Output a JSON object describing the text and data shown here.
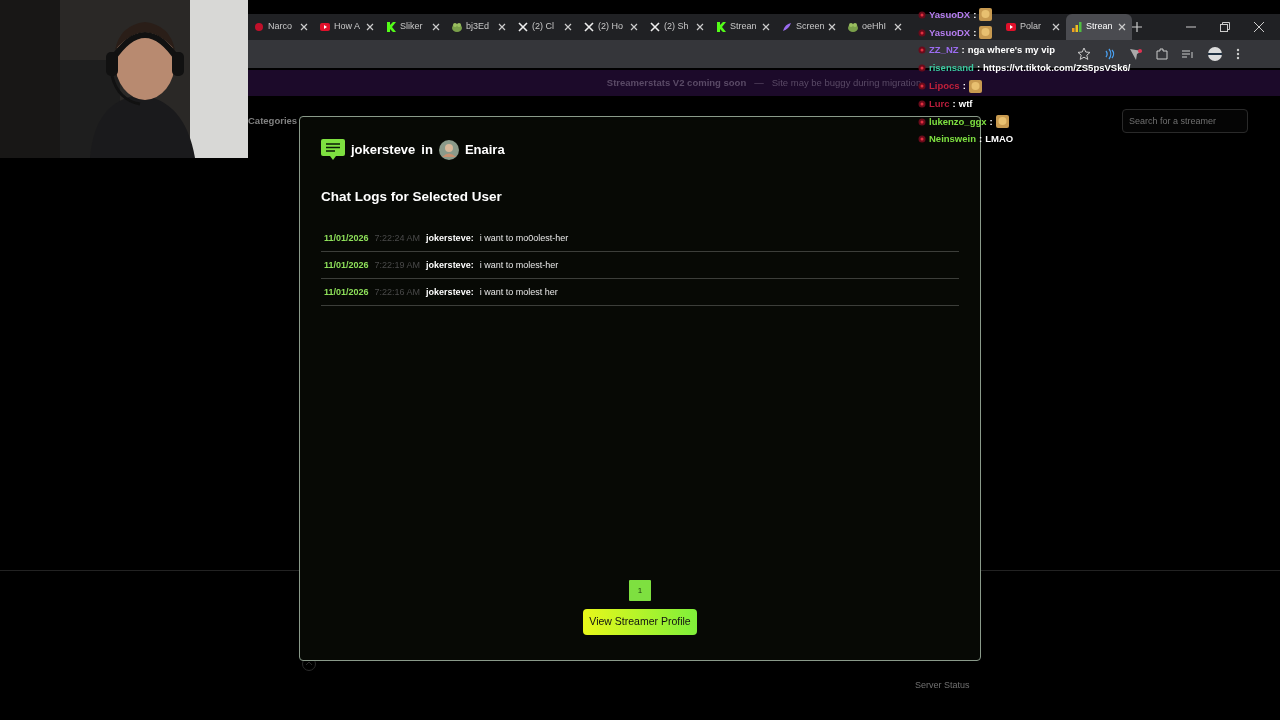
{
  "browser": {
    "tabs": [
      {
        "label": "Narco",
        "kind": "dot",
        "selected": false
      },
      {
        "label": "How A",
        "kind": "play",
        "selected": false
      },
      {
        "label": "Sliker",
        "kind": "k",
        "selected": false
      },
      {
        "label": "bj3Ed",
        "kind": "blob",
        "selected": false
      },
      {
        "label": "(2) Cl",
        "kind": "x",
        "selected": false
      },
      {
        "label": "(2) Ho",
        "kind": "x",
        "selected": false
      },
      {
        "label": "(2) Sh",
        "kind": "x",
        "selected": false
      },
      {
        "label": "Strean",
        "kind": "k",
        "selected": false
      },
      {
        "label": "Screen",
        "kind": "feather",
        "selected": false
      },
      {
        "label": "oeHhI",
        "kind": "blob",
        "selected": false
      },
      {
        "label": "Polar",
        "kind": "play",
        "selected": false
      },
      {
        "label": "Strean",
        "kind": "bars",
        "selected": true
      }
    ]
  },
  "banner": {
    "title": "Streamerstats V2 coming soon",
    "separator": "—",
    "message": "Site may be buggy during migration"
  },
  "nav": {
    "link": "Categories",
    "search": {
      "placeholder": "Search for a streamer"
    }
  },
  "modal": {
    "user": "jokersteve",
    "connector": "in",
    "streamer": "Enaira",
    "heading": "Chat Logs for Selected User",
    "messages": [
      {
        "date": "11/01/2026",
        "time": "7:22:24 AM",
        "user": "jokersteve:",
        "text": "i want to mo0olest-her"
      },
      {
        "date": "11/01/2026",
        "time": "7:22:19 AM",
        "user": "jokersteve:",
        "text": "i want to molest-her"
      },
      {
        "date": "11/01/2026",
        "time": "7:22:16 AM",
        "user": "jokersteve:",
        "text": "i want to molest her"
      }
    ],
    "pages": [
      {
        "label": "1",
        "selected": true
      }
    ],
    "button": "View Streamer Profile"
  },
  "footer": {
    "links": [
      "Server Status"
    ]
  },
  "stream_chat": [
    {
      "user": "YasuoDX",
      "color": "#b57cf0",
      "separator": ":",
      "kind": "emote"
    },
    {
      "user": "YasuoDX",
      "color": "#b57cf0",
      "separator": ":",
      "kind": "emote"
    },
    {
      "user": "ZZ_NZ",
      "color": "#9b6cf0",
      "separator": ":",
      "kind": "text",
      "text": "nga where's my vip"
    },
    {
      "user": "risensand",
      "color": "#3cc9a0",
      "separator": ":",
      "kind": "text",
      "text": "https://vt.tiktok.com/ZS5psVSk6/"
    },
    {
      "user": "Lipocs",
      "color": "#c0203a",
      "separator": ":",
      "kind": "emote"
    },
    {
      "user": "Lurc",
      "color": "#b81d3c",
      "separator": ":",
      "kind": "text",
      "text": "wtf"
    },
    {
      "user": "lukenzo_ggx",
      "color": "#7ee040",
      "separator": ":",
      "kind": "emote"
    },
    {
      "user": "Neinswein",
      "color": "#7ee041",
      "separator": ":",
      "kind": "text",
      "text": "LMAO"
    }
  ]
}
